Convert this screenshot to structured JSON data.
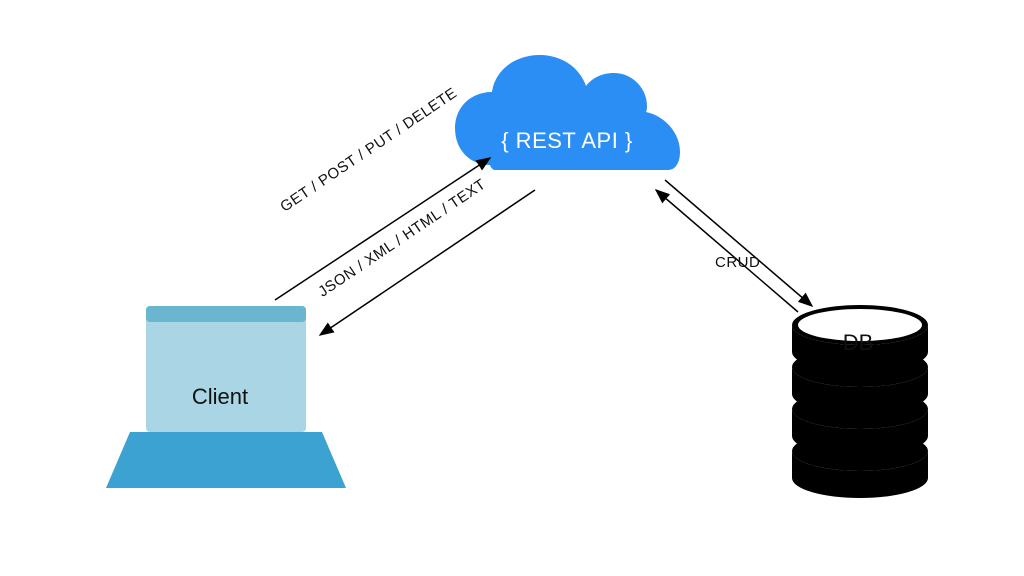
{
  "nodes": {
    "client": {
      "label": "Client"
    },
    "api": {
      "label": "{ REST API }"
    },
    "db": {
      "label": "DB"
    }
  },
  "edges": {
    "client_to_api": {
      "label": "GET / POST / PUT / DELETE"
    },
    "api_to_client": {
      "label": "JSON / XML / HTML / TEXT"
    },
    "api_db": {
      "label": "CRUD"
    }
  },
  "colors": {
    "cloud": "#2a8ef4",
    "laptop_screen": "#a9d5e5",
    "laptop_base": "#3ca2d1",
    "db": "#000000",
    "arrow": "#000000"
  }
}
